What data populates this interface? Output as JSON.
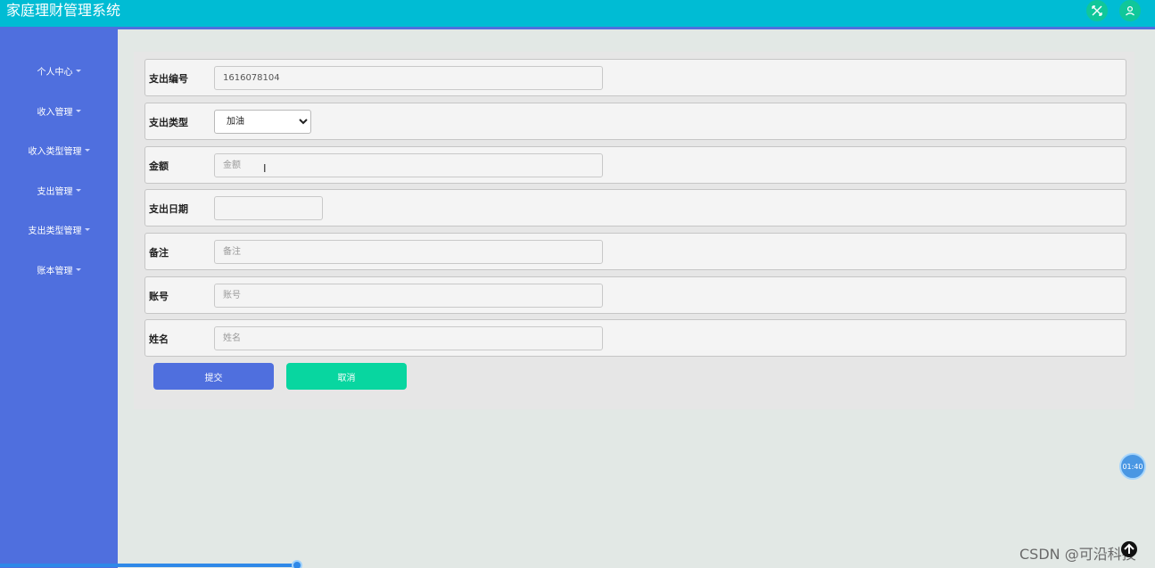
{
  "header": {
    "title": "家庭理财管理系统",
    "icons": [
      "fullscreen-icon",
      "user-icon"
    ],
    "color": "#00bcd4"
  },
  "sidebar": {
    "color": "#4f6fde",
    "items": [
      {
        "label": "个人中心"
      },
      {
        "label": "收入管理"
      },
      {
        "label": "收入类型管理"
      },
      {
        "label": "支出管理"
      },
      {
        "label": "支出类型管理"
      },
      {
        "label": "账本管理"
      }
    ]
  },
  "form": {
    "fields": [
      {
        "label": "支出编号",
        "value": "1616078104",
        "placeholder": ""
      },
      {
        "label": "支出类型",
        "value": "加油",
        "options": [
          "加油"
        ]
      },
      {
        "label": "金额",
        "value": "",
        "placeholder": "金额"
      },
      {
        "label": "支出日期",
        "value": "",
        "placeholder": ""
      },
      {
        "label": "备注",
        "value": "",
        "placeholder": "备注"
      },
      {
        "label": "账号",
        "value": "",
        "placeholder": "账号"
      },
      {
        "label": "姓名",
        "value": "",
        "placeholder": "姓名"
      }
    ],
    "submit_label": "提交",
    "cancel_label": "取消",
    "submit_color": "#4f6fde",
    "cancel_color": "#08d6a0"
  },
  "overlay": {
    "timer": "01:40",
    "watermark": "CSDN @可沿科技"
  }
}
